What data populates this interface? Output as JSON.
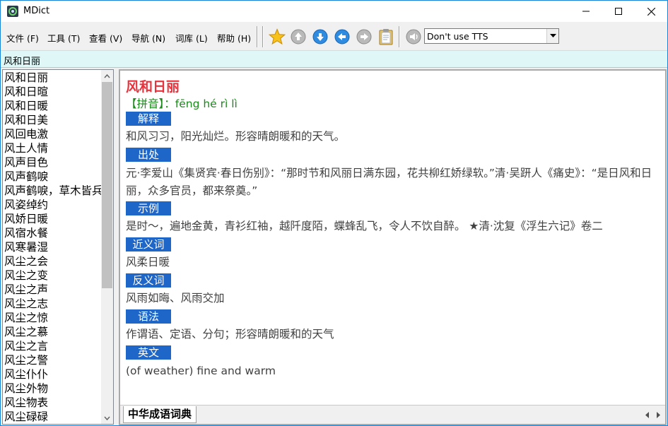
{
  "window": {
    "title": "MDict"
  },
  "menu": [
    {
      "label": "文件 (F)"
    },
    {
      "label": "工具 (T)"
    },
    {
      "label": "查看 (V)"
    },
    {
      "label": "导航 (N)"
    },
    {
      "label": "词库 (L)"
    },
    {
      "label": "帮助 (H)"
    }
  ],
  "toolbar": {
    "icons": [
      "star-icon",
      "up-arrow-icon",
      "down-arrow-icon",
      "back-arrow-icon",
      "forward-arrow-icon",
      "clipboard-icon",
      "speaker-icon"
    ],
    "tts_value": "Don't use TTS"
  },
  "search": {
    "value": "风和日丽"
  },
  "wordlist": {
    "items": [
      "风和日丽",
      "风和日暄",
      "风和日暖",
      "风和日美",
      "风回电激",
      "风土人情",
      "风声目色",
      "风声鹤唳",
      "风声鹤唳，草木皆兵",
      "风姿绰约",
      "风娇日暖",
      "风宿水餐",
      "风寒暑湿",
      "风尘之会",
      "风尘之变",
      "风尘之声",
      "风尘之志",
      "风尘之惊",
      "风尘之慕",
      "风尘之言",
      "风尘之警",
      "风尘仆仆",
      "风尘外物",
      "风尘物表",
      "风尘碌碌"
    ]
  },
  "entry": {
    "headword": "风和日丽",
    "pinyin_label": "【拼音】：",
    "pinyin": "fēng hé rì lì",
    "sections": [
      {
        "tag": "解释",
        "text": "和风习习，阳光灿烂。形容晴朗暖和的天气。"
      },
      {
        "tag": "出处",
        "text": "元·李爱山《集贤宾·春日伤别》：“那时节和风丽日满东园，花共柳红娇绿软。”清·吴趼人《痛史》：“是日风和日丽，众多官员，都来祭奠。”"
      },
      {
        "tag": "示例",
        "text": "是时～，遍地金黄，青衫红袖，越阡度陌，蝶蜂乱飞，令人不饮自醉。 ★清·沈复《浮生六记》卷二"
      },
      {
        "tag": "近义词",
        "text": "风柔日暖"
      },
      {
        "tag": "反义词",
        "text": "风雨如晦、风雨交加"
      },
      {
        "tag": "语法",
        "text": "作谓语、定语、分句；形容晴朗暖和的天气"
      },
      {
        "tag": "英文",
        "text": "(of weather) fine and warm"
      }
    ]
  },
  "dictionary_tab": {
    "label": "中华成语词典"
  },
  "colors": {
    "headword": "#e8323c",
    "pinyin": "#1a8a1a",
    "section_tag_bg": "#1f66c9",
    "search_strip_bg": "#e0f7f7",
    "window_border": "#1883d7"
  }
}
